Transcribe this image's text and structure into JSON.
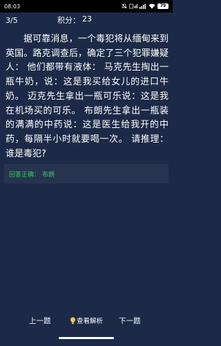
{
  "status_bar": {
    "time": "08:03",
    "battery_level": "79",
    "icons": [
      "bell-mute-icon",
      "hd-signal-icon",
      "signal-bars-icon",
      "wifi-icon",
      "battery-icon"
    ]
  },
  "header": {
    "progress": "3/5",
    "score_label": "积分：",
    "score_value": "23"
  },
  "question": {
    "text": "据可靠消息，一个毒犯将从缅甸来到英国。路克调查后，确定了三个犯罪嫌疑人： 他们都带有液体： 马克先生掏出一瓶牛奶，说：这是我买给女儿的进口牛奶。 迈克先生拿出一瓶可乐说：这是我在机场买的可乐。 布朗先生拿出一瓶装的满满的中药说：这是医生给我开的中药，每隔半小时就要喝一次。 请推理：谁是毒犯?"
  },
  "answer": {
    "label": "回答正确：",
    "value": "布朗",
    "color": "#3ec96a"
  },
  "bottom": {
    "prev_label": "上一题",
    "analysis_label": "查看解析",
    "analysis_icon": "lightbulb-icon",
    "next_label": "下一题"
  },
  "colors": {
    "background": "#1c2a47",
    "answer_box": "#26344f",
    "status_bar": "#000000"
  }
}
